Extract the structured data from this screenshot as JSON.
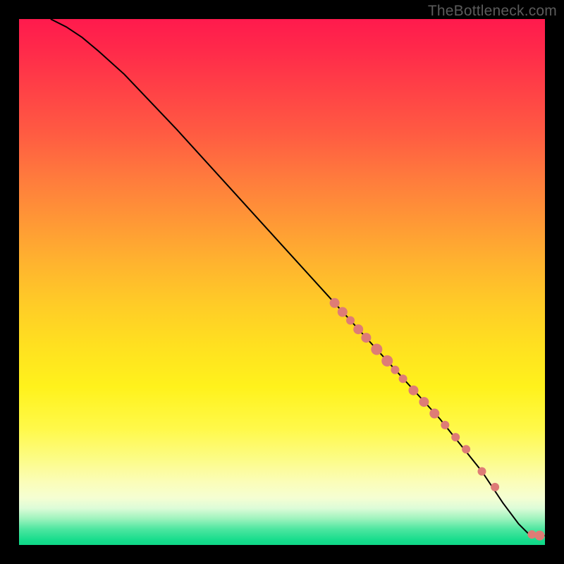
{
  "watermark": "TheBottleneck.com",
  "chart_data": {
    "type": "line",
    "title": "",
    "xlabel": "",
    "ylabel": "",
    "xlim": [
      0,
      100
    ],
    "ylim": [
      0,
      100
    ],
    "series": [
      {
        "name": "curve",
        "x": [
          6,
          9,
          12,
          15,
          20,
          30,
          40,
          50,
          60,
          70,
          80,
          88,
          92,
          95,
          97,
          99,
          100
        ],
        "y": [
          100,
          98.5,
          96.5,
          94,
          89.5,
          79,
          68,
          57,
          46,
          35,
          24,
          14,
          8,
          4,
          2,
          1.5,
          1.8
        ]
      }
    ],
    "points": {
      "name": "highlighted-points",
      "color": "#de7c76",
      "x": [
        60,
        61.5,
        63,
        64.5,
        66,
        68,
        70,
        71.5,
        73,
        75,
        77,
        79,
        81,
        83,
        85,
        88,
        90.5,
        97.5,
        99
      ],
      "y": [
        46,
        44.3,
        42.7,
        41,
        39.4,
        37.2,
        35,
        33.3,
        31.6,
        29.4,
        27.2,
        25,
        22.8,
        20.5,
        18.2,
        14,
        11,
        2,
        1.8
      ],
      "r": [
        7,
        7,
        6,
        7,
        7,
        8,
        8,
        6,
        6,
        7,
        7,
        7,
        6,
        6,
        6,
        6,
        6,
        6,
        7
      ]
    }
  }
}
